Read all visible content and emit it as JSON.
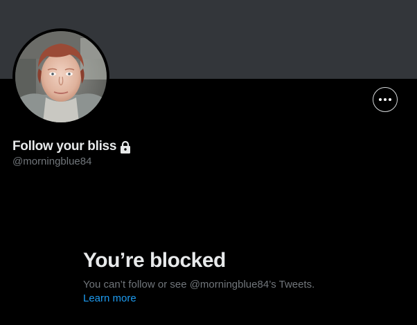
{
  "profile": {
    "display_name": "Follow your bliss",
    "handle": "@morningblue84",
    "protected_icon": "lock-icon",
    "more_icon": "more-horizontal-icon",
    "avatar_label": "profile-avatar"
  },
  "blocked": {
    "title": "You’re blocked",
    "description": "You can’t follow or see @morningblue84’s Tweets.",
    "learn_more": "Learn more"
  },
  "colors": {
    "background": "#000000",
    "banner": "#33363a",
    "primary_text": "#e7e9ea",
    "secondary_text": "#71767b",
    "link": "#1d9bf0",
    "button_border": "#d6d9db"
  }
}
